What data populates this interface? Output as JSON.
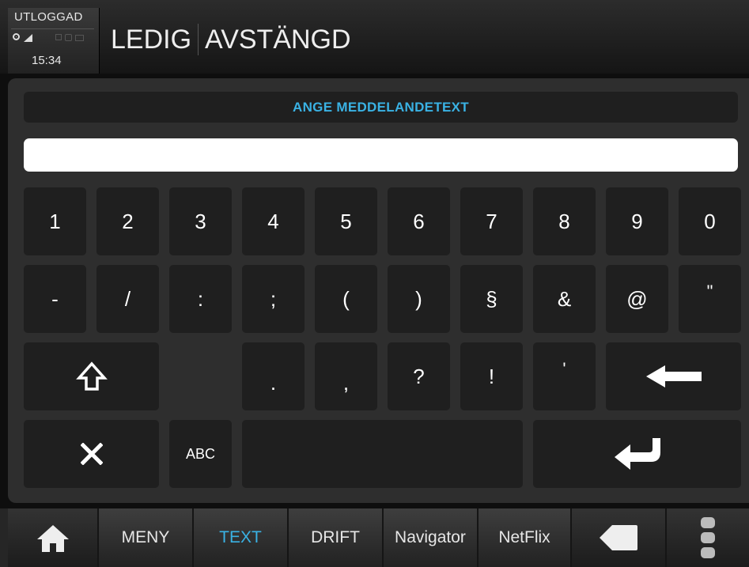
{
  "status": {
    "login_status": "UTLOGGAD",
    "time": "15:34",
    "title_left": "LEDIG",
    "title_right": "AVSTÄNGD",
    "icons": [
      "gps-icon",
      "signal-icon",
      "lock-icon",
      "phone-icon",
      "mail-icon"
    ]
  },
  "dialog": {
    "prompt": "ANGE MEDDELANDETEXT",
    "input_value": ""
  },
  "keyboard": {
    "row1": [
      "1",
      "2",
      "3",
      "4",
      "5",
      "6",
      "7",
      "8",
      "9",
      "0"
    ],
    "row2": [
      "-",
      "/",
      ":",
      ";",
      "(",
      ")",
      "§",
      "&",
      "@",
      "\""
    ],
    "row3": [
      ".",
      ",",
      "?",
      "!",
      "'"
    ],
    "abc_label": "ABC",
    "icons": {
      "shift": "shift-arrow-icon",
      "backspace": "backspace-arrow-icon",
      "cancel": "close-x-icon",
      "enter": "enter-return-icon"
    }
  },
  "bottom_nav": {
    "items": [
      "MENY",
      "TEXT",
      "DRIFT",
      "Navigator",
      "NetFlix"
    ],
    "active": "TEXT",
    "icons": [
      "home-icon",
      "back-icon",
      "more-vertical-icon"
    ]
  },
  "colors": {
    "accent": "#3ab2e4",
    "panel": "#2e2e2e",
    "key": "#1f1f1f"
  }
}
